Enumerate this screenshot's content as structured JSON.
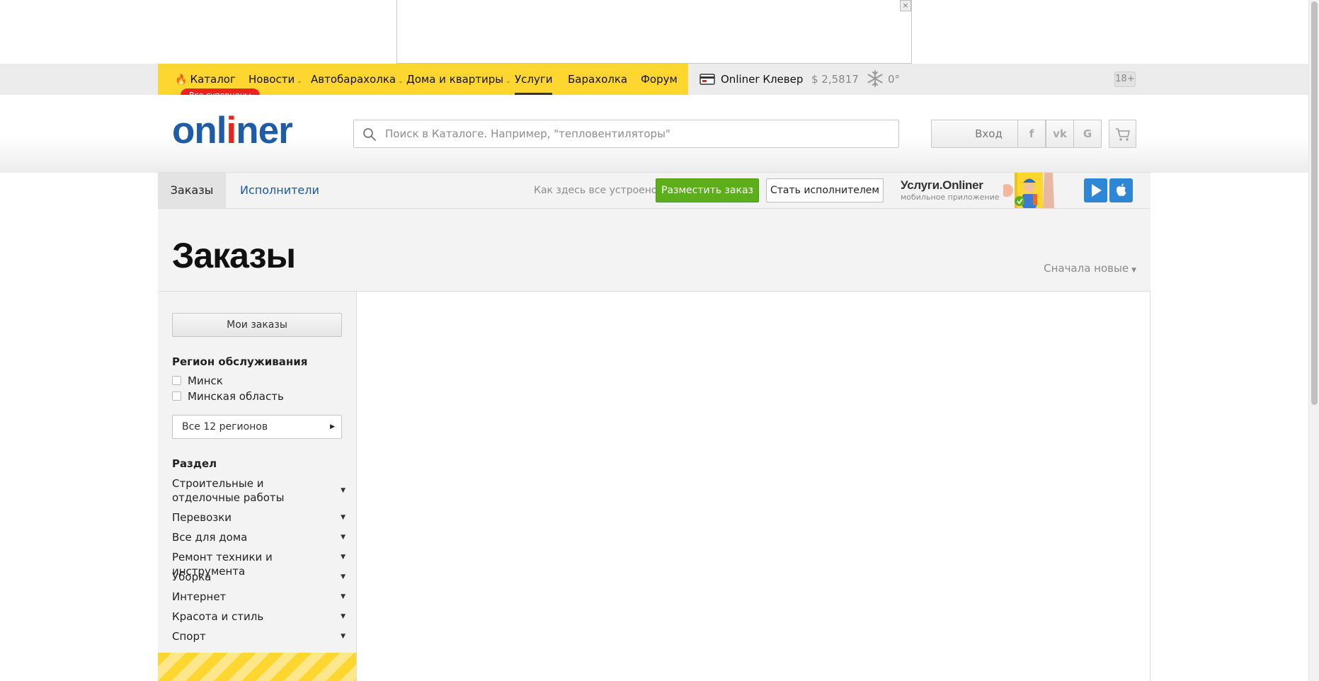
{
  "nav": {
    "items": [
      {
        "label": "Каталог"
      },
      {
        "label": "Новости"
      },
      {
        "label": "Автобарахолка"
      },
      {
        "label": "Дома и квартиры"
      },
      {
        "label": "Услуги"
      },
      {
        "label": "Барахолка"
      },
      {
        "label": "Форум"
      }
    ],
    "badge": "Все суперцены",
    "klever": "Onliner Клевер",
    "rate": "$ 2,5817",
    "weather": "0°",
    "age": "18+"
  },
  "header": {
    "logo_main": "onl",
    "logo_red": "i",
    "logo_end": "ner",
    "search_placeholder": "Поиск в Каталоге. Например, \"тепловентиляторы\"",
    "login": "Вход",
    "social": [
      "f",
      "vk",
      "G"
    ]
  },
  "subnav": {
    "tab_orders": "Заказы",
    "tab_performers": "Исполнители",
    "howto": "Как здесь все устроено?",
    "place_order": "Разместить заказ",
    "become_performer": "Стать исполнителем",
    "app_title": "Услуги.Onliner",
    "app_subtitle": "мобильное приложение"
  },
  "page": {
    "title": "Заказы",
    "sort": "Сначала новые"
  },
  "sidebar": {
    "my_orders": "Мои заказы",
    "region_title": "Регион обслуживания",
    "regions": [
      "Минск",
      "Минская область"
    ],
    "all_regions": "Все 12 регионов",
    "section_title": "Раздел",
    "categories": [
      "Строительные и отделочные работы",
      "Перевозки",
      "Все для дома",
      "Ремонт техники и инструмента",
      "Уборка",
      "Интернет",
      "Красота и стиль",
      "Спорт"
    ]
  }
}
